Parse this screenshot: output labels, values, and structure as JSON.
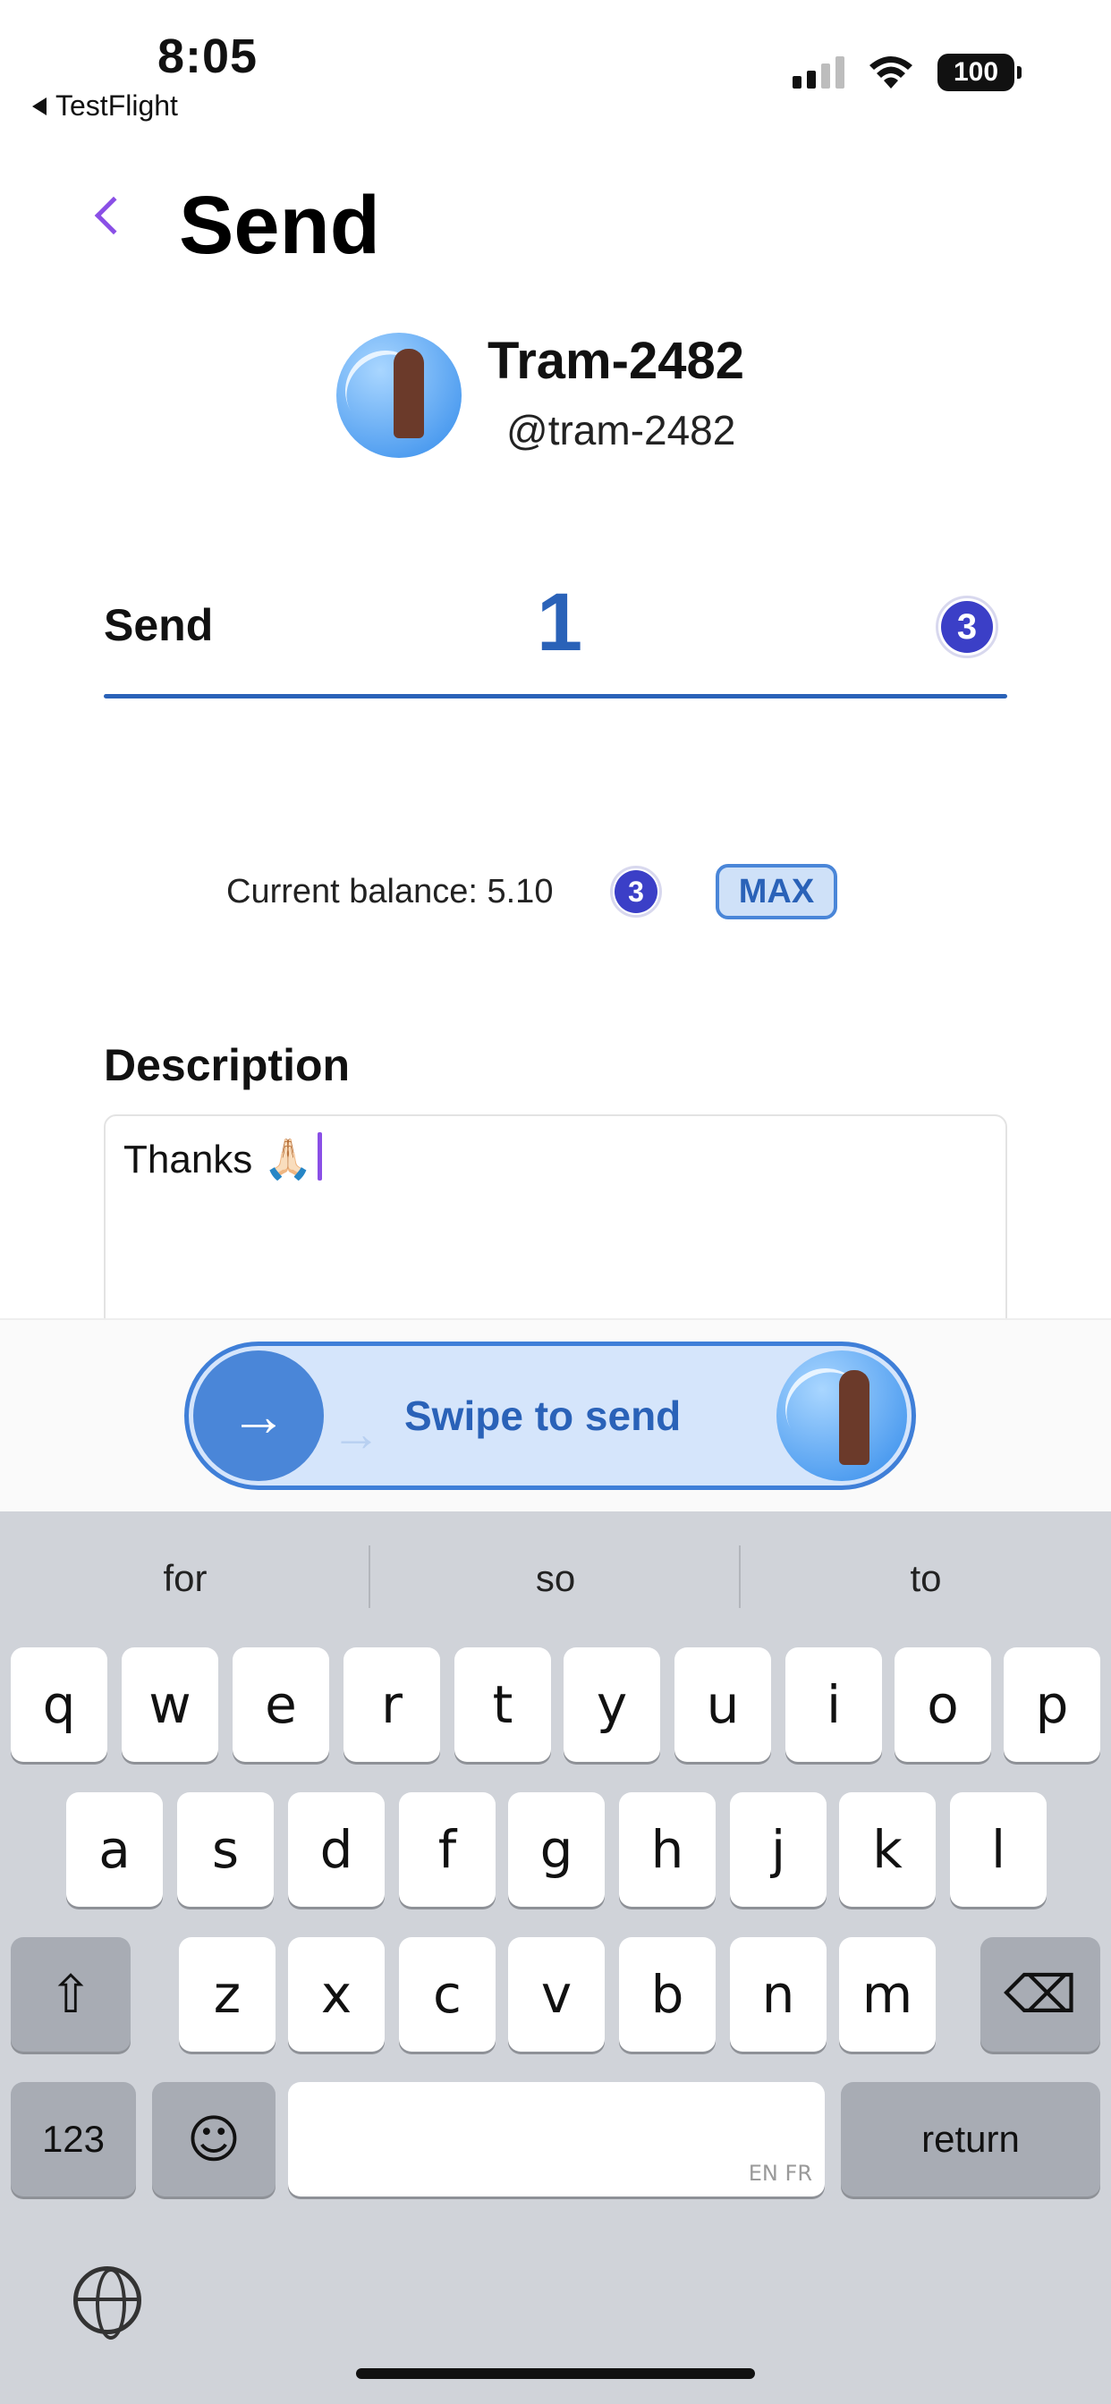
{
  "status_bar": {
    "time": "8:05",
    "back_app": "TestFlight",
    "battery": "100"
  },
  "header": {
    "title": "Send"
  },
  "recipient": {
    "name": "Tram-2482",
    "handle": "@tram-2482"
  },
  "send_row": {
    "label": "Send",
    "amount": "1",
    "token_icon": "token-icon",
    "token_glyph": "3"
  },
  "balance": {
    "text": "Current balance: 5.10",
    "max_label": "MAX"
  },
  "description": {
    "label": "Description",
    "value": "Thanks 🙏🏻"
  },
  "swipe": {
    "label": "Swipe to send",
    "arrow": "→",
    "trail": "→"
  },
  "keyboard": {
    "suggestions": [
      "for",
      "so",
      "to"
    ],
    "row1": [
      "q",
      "w",
      "e",
      "r",
      "t",
      "y",
      "u",
      "i",
      "o",
      "p"
    ],
    "row2": [
      "a",
      "s",
      "d",
      "f",
      "g",
      "h",
      "j",
      "k",
      "l"
    ],
    "row3": [
      "z",
      "x",
      "c",
      "v",
      "b",
      "n",
      "m"
    ],
    "shift": "⇧",
    "delete": "⌫",
    "numbers": "123",
    "emoji": "☺",
    "space_hint": "EN FR",
    "return": "return"
  }
}
